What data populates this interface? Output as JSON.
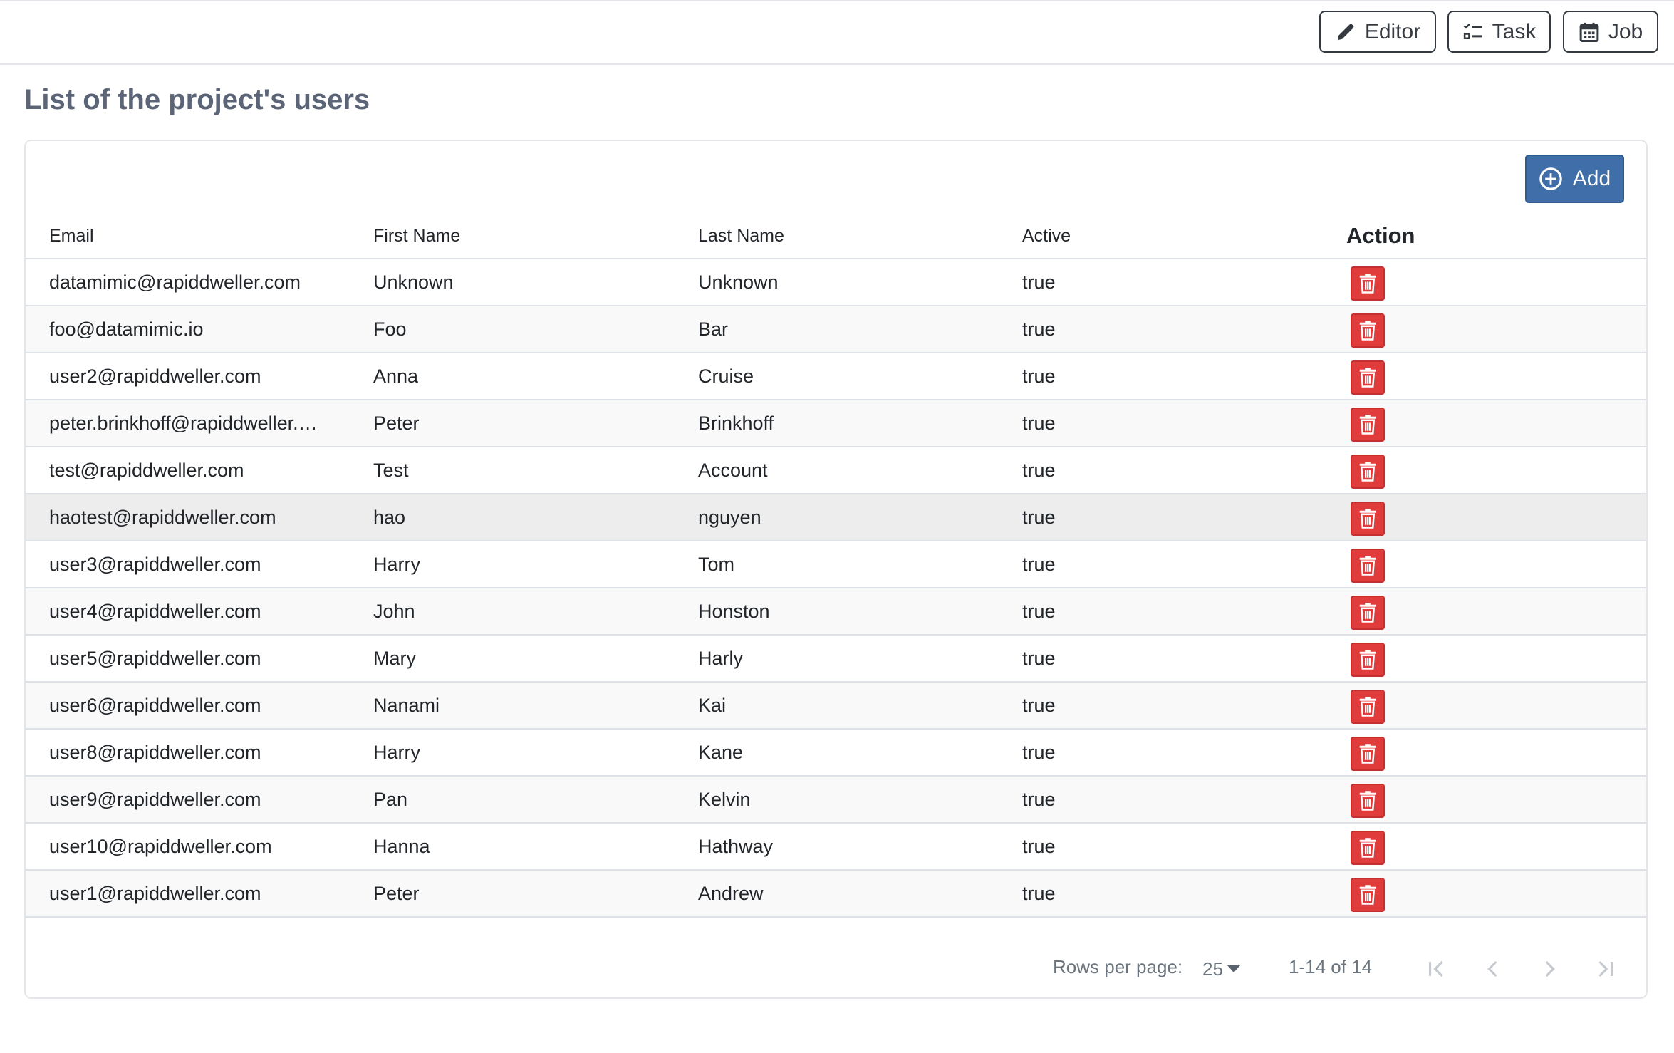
{
  "toolbar": {
    "editor_label": "Editor",
    "task_label": "Task",
    "job_label": "Job"
  },
  "page": {
    "title": "List of the project's users"
  },
  "card": {
    "add_label": "Add"
  },
  "table": {
    "headers": {
      "email": "Email",
      "first_name": "First Name",
      "last_name": "Last Name",
      "active": "Active",
      "action": "Action"
    },
    "rows": [
      {
        "email": "datamimic@rapiddweller.com",
        "first_name": "Unknown",
        "last_name": "Unknown",
        "active": "true"
      },
      {
        "email": "foo@datamimic.io",
        "first_name": "Foo",
        "last_name": "Bar",
        "active": "true"
      },
      {
        "email": "user2@rapiddweller.com",
        "first_name": "Anna",
        "last_name": "Cruise",
        "active": "true"
      },
      {
        "email": "peter.brinkhoff@rapiddweller.…",
        "first_name": "Peter",
        "last_name": "Brinkhoff",
        "active": "true"
      },
      {
        "email": "test@rapiddweller.com",
        "first_name": "Test",
        "last_name": "Account",
        "active": "true"
      },
      {
        "email": "haotest@rapiddweller.com",
        "first_name": "hao",
        "last_name": "nguyen",
        "active": "true"
      },
      {
        "email": "user3@rapiddweller.com",
        "first_name": "Harry",
        "last_name": "Tom",
        "active": "true"
      },
      {
        "email": "user4@rapiddweller.com",
        "first_name": "John",
        "last_name": "Honston",
        "active": "true"
      },
      {
        "email": "user5@rapiddweller.com",
        "first_name": "Mary",
        "last_name": "Harly",
        "active": "true"
      },
      {
        "email": "user6@rapiddweller.com",
        "first_name": "Nanami",
        "last_name": "Kai",
        "active": "true"
      },
      {
        "email": "user8@rapiddweller.com",
        "first_name": "Harry",
        "last_name": "Kane",
        "active": "true"
      },
      {
        "email": "user9@rapiddweller.com",
        "first_name": "Pan",
        "last_name": "Kelvin",
        "active": "true"
      },
      {
        "email": "user10@rapiddweller.com",
        "first_name": "Hanna",
        "last_name": "Hathway",
        "active": "true"
      },
      {
        "email": "user1@rapiddweller.com",
        "first_name": "Peter",
        "last_name": "Andrew",
        "active": "true"
      }
    ]
  },
  "pagination": {
    "rows_per_page_label": "Rows per page:",
    "rows_per_page_value": "25",
    "range_text": "1-14 of 14"
  },
  "colors": {
    "primary": "#3f6ea8",
    "danger": "#e03c3c",
    "title": "#5b6577"
  }
}
